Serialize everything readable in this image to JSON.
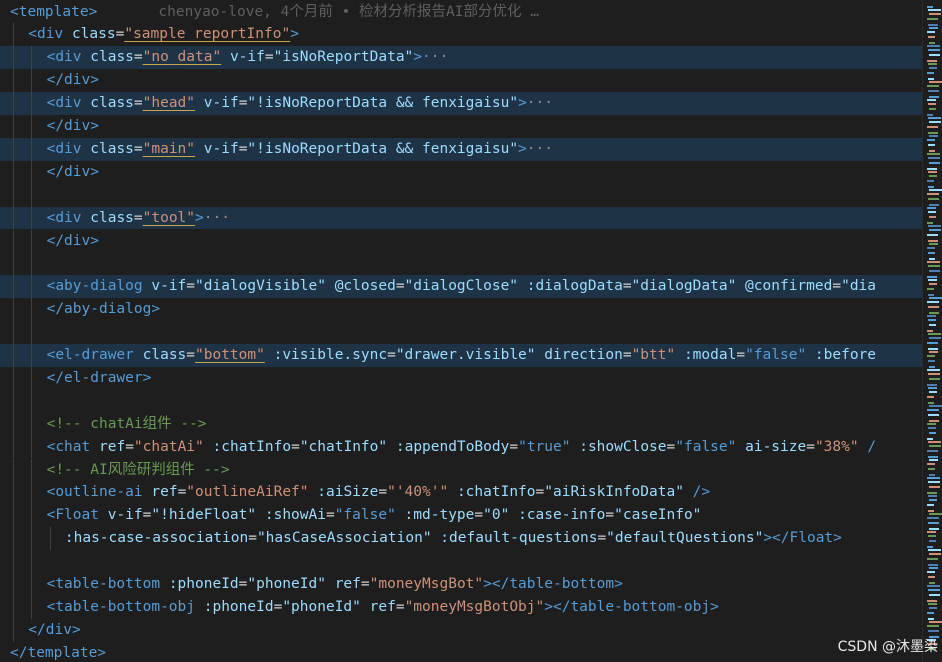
{
  "blame": "chenyao-love, 4个月前 • 检材分析报告AI部分优化 …",
  "watermark": "CSDN @沐墨染",
  "lines": [
    {
      "indent": 0,
      "segs": [
        {
          "c": "tag",
          "t": "<template>"
        },
        {
          "c": "blame",
          "t": "       "
        }
      ]
    },
    {
      "indent": 1,
      "segs": [
        {
          "c": "tag",
          "t": "<div "
        },
        {
          "c": "attr",
          "t": "class"
        },
        {
          "c": "plain",
          "t": "="
        },
        {
          "c": "str",
          "t": "\"sample_reportInfo\""
        },
        {
          "c": "tag",
          "t": ">"
        }
      ]
    },
    {
      "indent": 2,
      "hl": true,
      "segs": [
        {
          "c": "tag",
          "t": "<div "
        },
        {
          "c": "attr",
          "t": "class"
        },
        {
          "c": "plain",
          "t": "="
        },
        {
          "c": "str",
          "t": "\"no_data\""
        },
        {
          "c": "plain",
          "t": " "
        },
        {
          "c": "attr",
          "t": "v-if"
        },
        {
          "c": "plain",
          "t": "="
        },
        {
          "c": "attr",
          "t": "\"isNoReportData\""
        },
        {
          "c": "tag",
          "t": ">"
        },
        {
          "c": "dots",
          "t": "···"
        }
      ]
    },
    {
      "indent": 2,
      "segs": [
        {
          "c": "tag",
          "t": "</div>"
        }
      ]
    },
    {
      "indent": 2,
      "hl": true,
      "segs": [
        {
          "c": "tag",
          "t": "<div "
        },
        {
          "c": "attr",
          "t": "class"
        },
        {
          "c": "plain",
          "t": "="
        },
        {
          "c": "str",
          "t": "\"head\""
        },
        {
          "c": "plain",
          "t": " "
        },
        {
          "c": "attr",
          "t": "v-if"
        },
        {
          "c": "plain",
          "t": "="
        },
        {
          "c": "attr",
          "t": "\"!isNoReportData && fenxigaisu\""
        },
        {
          "c": "tag",
          "t": ">"
        },
        {
          "c": "dots",
          "t": "···"
        }
      ]
    },
    {
      "indent": 2,
      "segs": [
        {
          "c": "tag",
          "t": "</div>"
        }
      ]
    },
    {
      "indent": 2,
      "hl": true,
      "segs": [
        {
          "c": "tag",
          "t": "<div "
        },
        {
          "c": "attr",
          "t": "class"
        },
        {
          "c": "plain",
          "t": "="
        },
        {
          "c": "str",
          "t": "\"main\""
        },
        {
          "c": "plain",
          "t": " "
        },
        {
          "c": "attr",
          "t": "v-if"
        },
        {
          "c": "plain",
          "t": "="
        },
        {
          "c": "attr",
          "t": "\"!isNoReportData && fenxigaisu\""
        },
        {
          "c": "tag",
          "t": ">"
        },
        {
          "c": "dots",
          "t": "···"
        }
      ]
    },
    {
      "indent": 2,
      "segs": [
        {
          "c": "tag",
          "t": "</div>"
        }
      ]
    },
    {
      "indent": 2,
      "segs": []
    },
    {
      "indent": 2,
      "hl": true,
      "segs": [
        {
          "c": "tag",
          "t": "<div "
        },
        {
          "c": "attr",
          "t": "class"
        },
        {
          "c": "plain",
          "t": "="
        },
        {
          "c": "str",
          "t": "\"tool\""
        },
        {
          "c": "tag",
          "t": ">"
        },
        {
          "c": "dots",
          "t": "···"
        }
      ]
    },
    {
      "indent": 2,
      "segs": [
        {
          "c": "tag",
          "t": "</div>"
        }
      ]
    },
    {
      "indent": 2,
      "segs": []
    },
    {
      "indent": 2,
      "hl": true,
      "segs": [
        {
          "c": "tag",
          "t": "<aby-dialog "
        },
        {
          "c": "attr",
          "t": "v-if"
        },
        {
          "c": "plain",
          "t": "="
        },
        {
          "c": "attr",
          "t": "\"dialogVisible\""
        },
        {
          "c": "plain",
          "t": " "
        },
        {
          "c": "attr",
          "t": "@closed"
        },
        {
          "c": "plain",
          "t": "="
        },
        {
          "c": "attr",
          "t": "\"dialogClose\""
        },
        {
          "c": "plain",
          "t": " "
        },
        {
          "c": "attr",
          "t": ":dialogData"
        },
        {
          "c": "plain",
          "t": "="
        },
        {
          "c": "attr",
          "t": "\"dialogData\""
        },
        {
          "c": "plain",
          "t": " "
        },
        {
          "c": "attr",
          "t": "@confirmed"
        },
        {
          "c": "plain",
          "t": "="
        },
        {
          "c": "attr",
          "t": "\"dia"
        }
      ]
    },
    {
      "indent": 2,
      "segs": [
        {
          "c": "tag",
          "t": "</aby-dialog>"
        }
      ]
    },
    {
      "indent": 2,
      "segs": []
    },
    {
      "indent": 2,
      "hl": true,
      "segs": [
        {
          "c": "tag",
          "t": "<el-drawer "
        },
        {
          "c": "attr",
          "t": "class"
        },
        {
          "c": "plain",
          "t": "="
        },
        {
          "c": "str",
          "t": "\"bottom\""
        },
        {
          "c": "plain",
          "t": " "
        },
        {
          "c": "attr",
          "t": ":visible.sync"
        },
        {
          "c": "plain",
          "t": "="
        },
        {
          "c": "attr",
          "t": "\"drawer.visible\""
        },
        {
          "c": "plain",
          "t": " "
        },
        {
          "c": "attr",
          "t": "direction"
        },
        {
          "c": "plain",
          "t": "="
        },
        {
          "c": "str",
          "t": "\"btt\""
        },
        {
          "c": "plain",
          "t": " "
        },
        {
          "c": "attr",
          "t": ":modal"
        },
        {
          "c": "plain",
          "t": "="
        },
        {
          "c": "tag",
          "t": "\"false\""
        },
        {
          "c": "plain",
          "t": " "
        },
        {
          "c": "attr",
          "t": ":before"
        }
      ]
    },
    {
      "indent": 2,
      "segs": [
        {
          "c": "tag",
          "t": "</el-drawer>"
        }
      ]
    },
    {
      "indent": 2,
      "segs": []
    },
    {
      "indent": 2,
      "segs": [
        {
          "c": "cmt",
          "t": "<!-- chatAi组件 -->"
        }
      ]
    },
    {
      "indent": 2,
      "segs": [
        {
          "c": "tag",
          "t": "<chat "
        },
        {
          "c": "attr",
          "t": "ref"
        },
        {
          "c": "plain",
          "t": "="
        },
        {
          "c": "str",
          "t": "\"chatAi\""
        },
        {
          "c": "plain",
          "t": " "
        },
        {
          "c": "attr",
          "t": ":chatInfo"
        },
        {
          "c": "plain",
          "t": "="
        },
        {
          "c": "attr",
          "t": "\"chatInfo\""
        },
        {
          "c": "plain",
          "t": " "
        },
        {
          "c": "attr",
          "t": ":appendToBody"
        },
        {
          "c": "plain",
          "t": "="
        },
        {
          "c": "tag",
          "t": "\"true\""
        },
        {
          "c": "plain",
          "t": " "
        },
        {
          "c": "attr",
          "t": ":showClose"
        },
        {
          "c": "plain",
          "t": "="
        },
        {
          "c": "tag",
          "t": "\"false\""
        },
        {
          "c": "plain",
          "t": " "
        },
        {
          "c": "attr",
          "t": "ai-size"
        },
        {
          "c": "plain",
          "t": "="
        },
        {
          "c": "str",
          "t": "\"38%\""
        },
        {
          "c": "plain",
          "t": " "
        },
        {
          "c": "tag",
          "t": "/"
        }
      ]
    },
    {
      "indent": 2,
      "segs": [
        {
          "c": "cmt",
          "t": "<!-- AI风险研判组件 -->"
        }
      ]
    },
    {
      "indent": 2,
      "segs": [
        {
          "c": "tag",
          "t": "<outline-ai "
        },
        {
          "c": "attr",
          "t": "ref"
        },
        {
          "c": "plain",
          "t": "="
        },
        {
          "c": "str",
          "t": "\"outlineAiRef\""
        },
        {
          "c": "plain",
          "t": " "
        },
        {
          "c": "attr",
          "t": ":aiSize"
        },
        {
          "c": "plain",
          "t": "="
        },
        {
          "c": "str",
          "t": "\"'40%'\""
        },
        {
          "c": "plain",
          "t": " "
        },
        {
          "c": "attr",
          "t": ":chatInfo"
        },
        {
          "c": "plain",
          "t": "="
        },
        {
          "c": "attr",
          "t": "\"aiRiskInfoData\""
        },
        {
          "c": "plain",
          "t": " "
        },
        {
          "c": "tag",
          "t": "/>"
        }
      ]
    },
    {
      "indent": 2,
      "segs": [
        {
          "c": "tag",
          "t": "<Float "
        },
        {
          "c": "attr",
          "t": "v-if"
        },
        {
          "c": "plain",
          "t": "="
        },
        {
          "c": "attr",
          "t": "\"!hideFloat\""
        },
        {
          "c": "plain",
          "t": " "
        },
        {
          "c": "attr",
          "t": ":showAi"
        },
        {
          "c": "plain",
          "t": "="
        },
        {
          "c": "tag",
          "t": "\"false\""
        },
        {
          "c": "plain",
          "t": " "
        },
        {
          "c": "attr",
          "t": ":md-type"
        },
        {
          "c": "plain",
          "t": "="
        },
        {
          "c": "attr",
          "t": "\"0\""
        },
        {
          "c": "plain",
          "t": " "
        },
        {
          "c": "attr",
          "t": ":case-info"
        },
        {
          "c": "plain",
          "t": "="
        },
        {
          "c": "attr",
          "t": "\"caseInfo\""
        }
      ]
    },
    {
      "indent": 3,
      "segs": [
        {
          "c": "attr",
          "t": ":has-case-association"
        },
        {
          "c": "plain",
          "t": "="
        },
        {
          "c": "attr",
          "t": "\"hasCaseAssociation\""
        },
        {
          "c": "plain",
          "t": " "
        },
        {
          "c": "attr",
          "t": ":default-questions"
        },
        {
          "c": "plain",
          "t": "="
        },
        {
          "c": "attr",
          "t": "\"defaultQuestions\""
        },
        {
          "c": "tag",
          "t": "></Float>"
        }
      ]
    },
    {
      "indent": 2,
      "segs": []
    },
    {
      "indent": 2,
      "segs": [
        {
          "c": "tag",
          "t": "<table-bottom "
        },
        {
          "c": "attr",
          "t": ":phoneId"
        },
        {
          "c": "plain",
          "t": "="
        },
        {
          "c": "attr",
          "t": "\"phoneId\""
        },
        {
          "c": "plain",
          "t": " "
        },
        {
          "c": "attr",
          "t": "ref"
        },
        {
          "c": "plain",
          "t": "="
        },
        {
          "c": "str",
          "t": "\"moneyMsgBot\""
        },
        {
          "c": "tag",
          "t": "></table-bottom>"
        }
      ]
    },
    {
      "indent": 2,
      "segs": [
        {
          "c": "tag",
          "t": "<table-bottom-obj "
        },
        {
          "c": "attr",
          "t": ":phoneId"
        },
        {
          "c": "plain",
          "t": "="
        },
        {
          "c": "attr",
          "t": "\"phoneId\""
        },
        {
          "c": "plain",
          "t": " "
        },
        {
          "c": "attr",
          "t": "ref"
        },
        {
          "c": "plain",
          "t": "="
        },
        {
          "c": "str",
          "t": "\"moneyMsgBotObj\""
        },
        {
          "c": "tag",
          "t": "></table-bottom-obj>"
        }
      ]
    },
    {
      "indent": 1,
      "segs": [
        {
          "c": "tag",
          "t": "</div>"
        }
      ]
    },
    {
      "indent": 0,
      "segs": [
        {
          "c": "tag",
          "t": "</template>"
        }
      ]
    }
  ]
}
